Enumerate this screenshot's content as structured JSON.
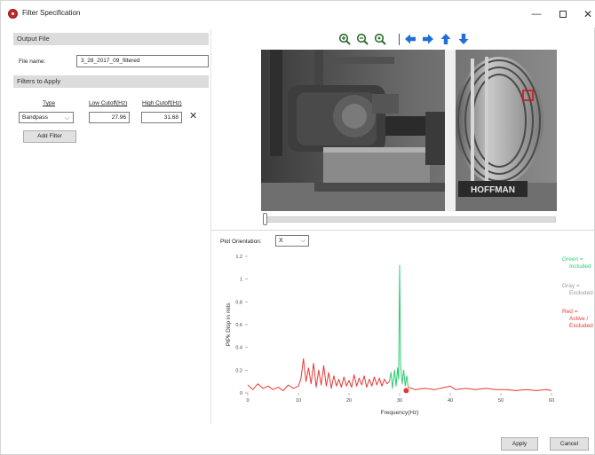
{
  "window": {
    "title": "Filter Specification",
    "minimize_glyph": "—",
    "close_glyph": "✕"
  },
  "output_file": {
    "header": "Output File",
    "file_name_label": "File name:",
    "file_name_value": "3_28_2017_09_filtered"
  },
  "filters": {
    "header": "Filters to Apply",
    "columns": {
      "type": "Type",
      "low": "Low Cutoff(Hz)",
      "high": "High Cutoff(Hz)"
    },
    "rows": [
      {
        "type": "Bandpass",
        "low": "27.96",
        "high": "31.68"
      }
    ],
    "chevron": "⌵",
    "remove_glyph": "✕",
    "add_button": "Add Filter"
  },
  "toolbar": {
    "icons": [
      "zoom-in-icon",
      "zoom-out-icon",
      "zoom-reset-icon",
      "arrow-left-icon",
      "arrow-right-icon",
      "arrow-up-icon",
      "arrow-down-icon"
    ],
    "accent": "#1e6fd6"
  },
  "image": {
    "brand_plate": "HOFFMAN",
    "slider_fraction": 0.0
  },
  "plot": {
    "orientation_label": "Plot Orientation:",
    "orientation_value": "X",
    "chevron": "⌵"
  },
  "legend": {
    "green": [
      "Green =",
      "Included"
    ],
    "gray": [
      "Gray =",
      "Excluded"
    ],
    "red": [
      "Red =",
      "Active /",
      "Excluded"
    ],
    "colors": {
      "green": "#2ecc71",
      "gray": "#9a9a9a",
      "red": "#e53935"
    }
  },
  "chart_data": {
    "type": "line",
    "xlabel": "Frequency(Hz)",
    "ylabel": "PtPk Disp in mils",
    "xlim": [
      0,
      60
    ],
    "ylim": [
      0,
      1.2
    ],
    "xticks": [
      0,
      10,
      20,
      30,
      40,
      50,
      60
    ],
    "yticks": [
      0,
      0.2,
      0.4,
      0.6,
      0.8,
      1,
      1.2
    ],
    "xtick_labels": [
      "0",
      "10",
      "20",
      "30",
      "40",
      "50",
      "60"
    ],
    "ytick_labels": [
      "0",
      "0.2",
      "0.4",
      "0.6",
      "0.8",
      "1",
      "1.2"
    ],
    "series": [
      {
        "color": "red",
        "x": [
          0,
          1,
          2,
          3,
          4,
          5,
          6,
          7,
          8,
          9,
          10,
          10.5,
          11,
          11.5,
          12,
          12.5,
          13,
          13.5,
          14,
          14.5,
          15,
          15.5,
          16,
          16.5,
          17,
          17.5,
          18,
          18.5,
          19,
          19.5,
          20,
          20.5,
          21,
          21.5,
          22,
          22.5,
          23,
          23.5,
          24,
          24.5,
          25,
          25.5,
          26,
          26.5,
          27,
          27.5,
          27.96
        ],
        "y": [
          0.07,
          0.03,
          0.08,
          0.04,
          0.06,
          0.03,
          0.05,
          0.02,
          0.07,
          0.04,
          0.06,
          0.12,
          0.3,
          0.1,
          0.22,
          0.08,
          0.26,
          0.05,
          0.2,
          0.07,
          0.24,
          0.06,
          0.18,
          0.04,
          0.15,
          0.06,
          0.12,
          0.05,
          0.14,
          0.06,
          0.11,
          0.05,
          0.16,
          0.06,
          0.13,
          0.07,
          0.15,
          0.05,
          0.12,
          0.06,
          0.14,
          0.07,
          0.13,
          0.06,
          0.12,
          0.08,
          0.1
        ]
      },
      {
        "color": "green",
        "x": [
          27.96,
          28.3,
          28.6,
          29,
          29.3,
          29.6,
          29.8,
          30,
          30.2,
          30.5,
          30.8,
          31.1,
          31.4,
          31.68
        ],
        "y": [
          0.1,
          0.18,
          0.04,
          0.2,
          0.06,
          0.22,
          0.12,
          1.12,
          0.25,
          0.08,
          0.2,
          0.06,
          0.15,
          0.05
        ]
      },
      {
        "color": "red",
        "x": [
          31.68,
          33,
          35,
          37,
          39,
          40,
          41,
          43,
          45,
          47,
          49,
          51,
          53,
          55,
          57,
          59,
          60
        ],
        "y": [
          0.05,
          0.03,
          0.04,
          0.03,
          0.05,
          0.06,
          0.03,
          0.04,
          0.03,
          0.04,
          0.03,
          0.03,
          0.02,
          0.03,
          0.02,
          0.03,
          0.02
        ]
      }
    ],
    "marker": {
      "x": 31.3,
      "y": 0.02,
      "color": "red"
    },
    "grid": false
  },
  "actions": {
    "apply": "Apply",
    "cancel": "Cancel"
  }
}
